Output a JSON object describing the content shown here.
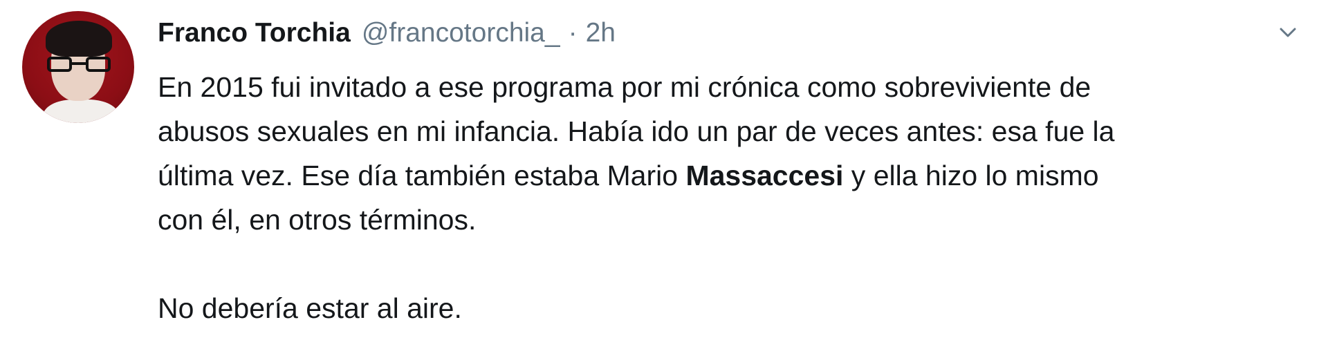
{
  "tweet": {
    "author_name": "Franco Torchia",
    "handle": "@francotorchia_",
    "separator": "·",
    "time": "2h",
    "menu_icon": "chevron-down-icon",
    "avatar_icon": "avatar",
    "body": {
      "line1": "En 2015 fui invitado a ese programa por mi crónica como sobreviviente de",
      "line2": "abusos sexuales en mi infancia. Había ido un par de veces antes: esa fue la",
      "line3_pre": "última vez. Ese día también estaba Mario ",
      "line3_bold": "Massaccesi",
      "line3_post": " y ella hizo lo mismo",
      "line4": "con él, en otros términos.",
      "line5": "No debería estar al aire."
    }
  },
  "colors": {
    "primary_text": "#14171a",
    "secondary_text": "#657786",
    "avatar_bg": "#a0141c"
  }
}
